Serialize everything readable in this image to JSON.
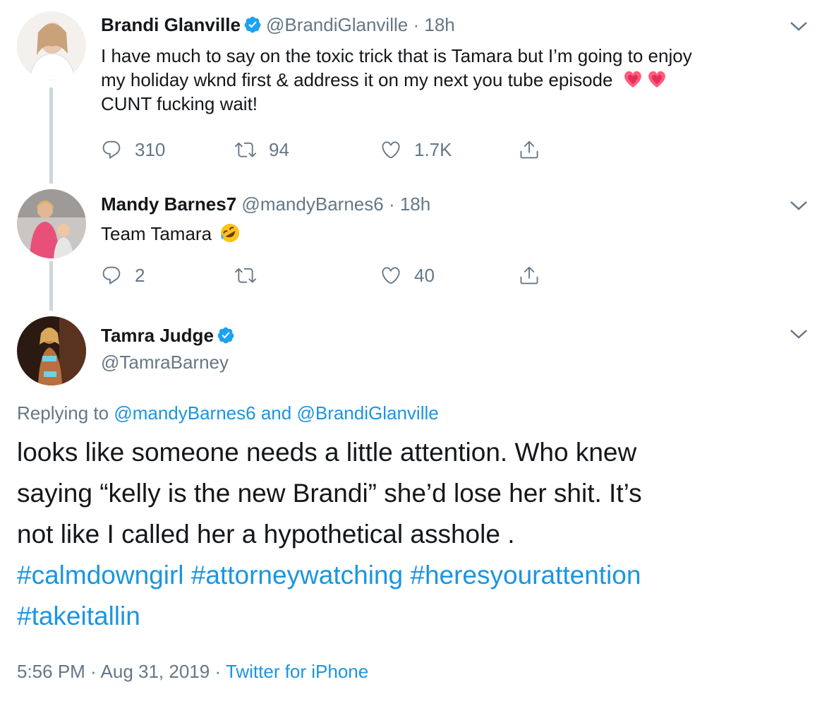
{
  "tweets": [
    {
      "name": "Brandi Glanville",
      "handle": "@BrandiGlanville",
      "sep": "·",
      "time": "18h",
      "text_line1": "I have much to say on the toxic trick that is Tamara but I’m going to enjoy",
      "text_line2": "my holiday wknd first & address it on my next you tube episode",
      "text_line3": "CUNT  fucking wait!",
      "replies": "310",
      "retweets": "94",
      "likes": "1.7K"
    },
    {
      "name": "Mandy Barnes7",
      "handle": "@mandyBarnes6",
      "sep": "·",
      "time": "18h",
      "text": "Team Tamara",
      "replies": "2",
      "retweets": "",
      "likes": "40"
    }
  ],
  "main": {
    "name": "Tamra Judge",
    "handle": "@TamraBarney",
    "replying_prefix": "Replying to",
    "reply_to_1": "@mandyBarnes6",
    "reply_and": "and",
    "reply_to_2": "@BrandiGlanville",
    "text_line1": "looks like someone needs  a little attention. Who knew",
    "text_line2": "saying “kelly  is the new Brandi” she’d lose her shit.  It’s",
    "text_line3": "not like I called her a hypothetical asshole .",
    "hashtags_line1": [
      "#calmdowngirl",
      "#attorneywatching",
      "#heresyourattention"
    ],
    "hashtags_line2": [
      "#takeitallin"
    ],
    "time": "5:56 PM",
    "date": "Aug 31, 2019",
    "sep": "·",
    "source": "Twitter for iPhone"
  },
  "colors": {
    "link": "#1b95e0",
    "muted": "#657786",
    "verified": "#1da1f2",
    "thread_line": "#ccd6dd"
  },
  "icons": [
    "reply-icon",
    "retweet-icon",
    "like-icon",
    "share-icon",
    "verified-badge-icon",
    "chevron-down-icon",
    "heart-emoji",
    "rofl-emoji"
  ]
}
